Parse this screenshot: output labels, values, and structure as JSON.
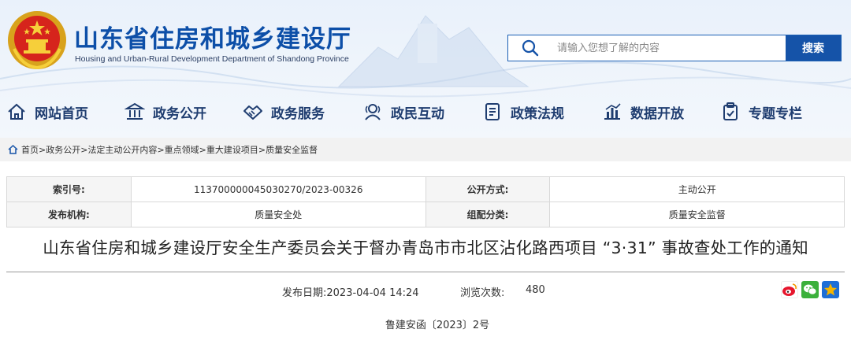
{
  "header": {
    "title": "山东省住房和城乡建设厅",
    "subtitle": "Housing and Urban-Rural Development Department of Shandong Province",
    "colors": {
      "primary": "#0d4fa8",
      "nav_text": "#1f3d70",
      "search_button": "#1553a8"
    }
  },
  "search": {
    "placeholder": "请输入您想了解的内容",
    "button_label": "搜索",
    "icon": "search-icon"
  },
  "nav": {
    "items": [
      {
        "label": "网站首页",
        "icon": "home-icon"
      },
      {
        "label": "政务公开",
        "icon": "government-building-icon"
      },
      {
        "label": "政务服务",
        "icon": "handshake-icon"
      },
      {
        "label": "政民互动",
        "icon": "people-interaction-icon"
      },
      {
        "label": "政策法规",
        "icon": "document-icon"
      },
      {
        "label": "数据开放",
        "icon": "bar-chart-icon"
      },
      {
        "label": "专题专栏",
        "icon": "clipboard-icon"
      }
    ]
  },
  "breadcrumb": {
    "icon": "home-small-icon",
    "items": [
      "首页",
      "政务公开",
      "法定主动公开内容",
      "重点领域",
      "重大建设项目",
      "质量安全监督"
    ],
    "separator": ">"
  },
  "info_table": {
    "index_label": "索引号:",
    "index_value": "113700000045030270/2023-00326",
    "disclosure_label": "公开方式:",
    "disclosure_value": "主动公开",
    "publisher_label": "发布机构:",
    "publisher_value": "质量安全处",
    "category_label": "组配分类:",
    "category_value": "质量安全监督"
  },
  "article": {
    "title": "山东省住房和城乡建设厅安全生产委员会关于督办青岛市市北区沾化路西项目 “3·31” 事故查处工作的通知",
    "publish_label": "发布日期:",
    "publish_date": "2023-04-04 14:24",
    "views_label": "浏览次数:",
    "views": "480",
    "doc_number": "鲁建安函〔2023〕2号"
  },
  "share": [
    {
      "icon": "weibo-icon",
      "color": "#e6162d"
    },
    {
      "icon": "wechat-icon",
      "color": "#3bb03b"
    },
    {
      "icon": "qzone-star-icon",
      "color": "#f5b400"
    }
  ]
}
